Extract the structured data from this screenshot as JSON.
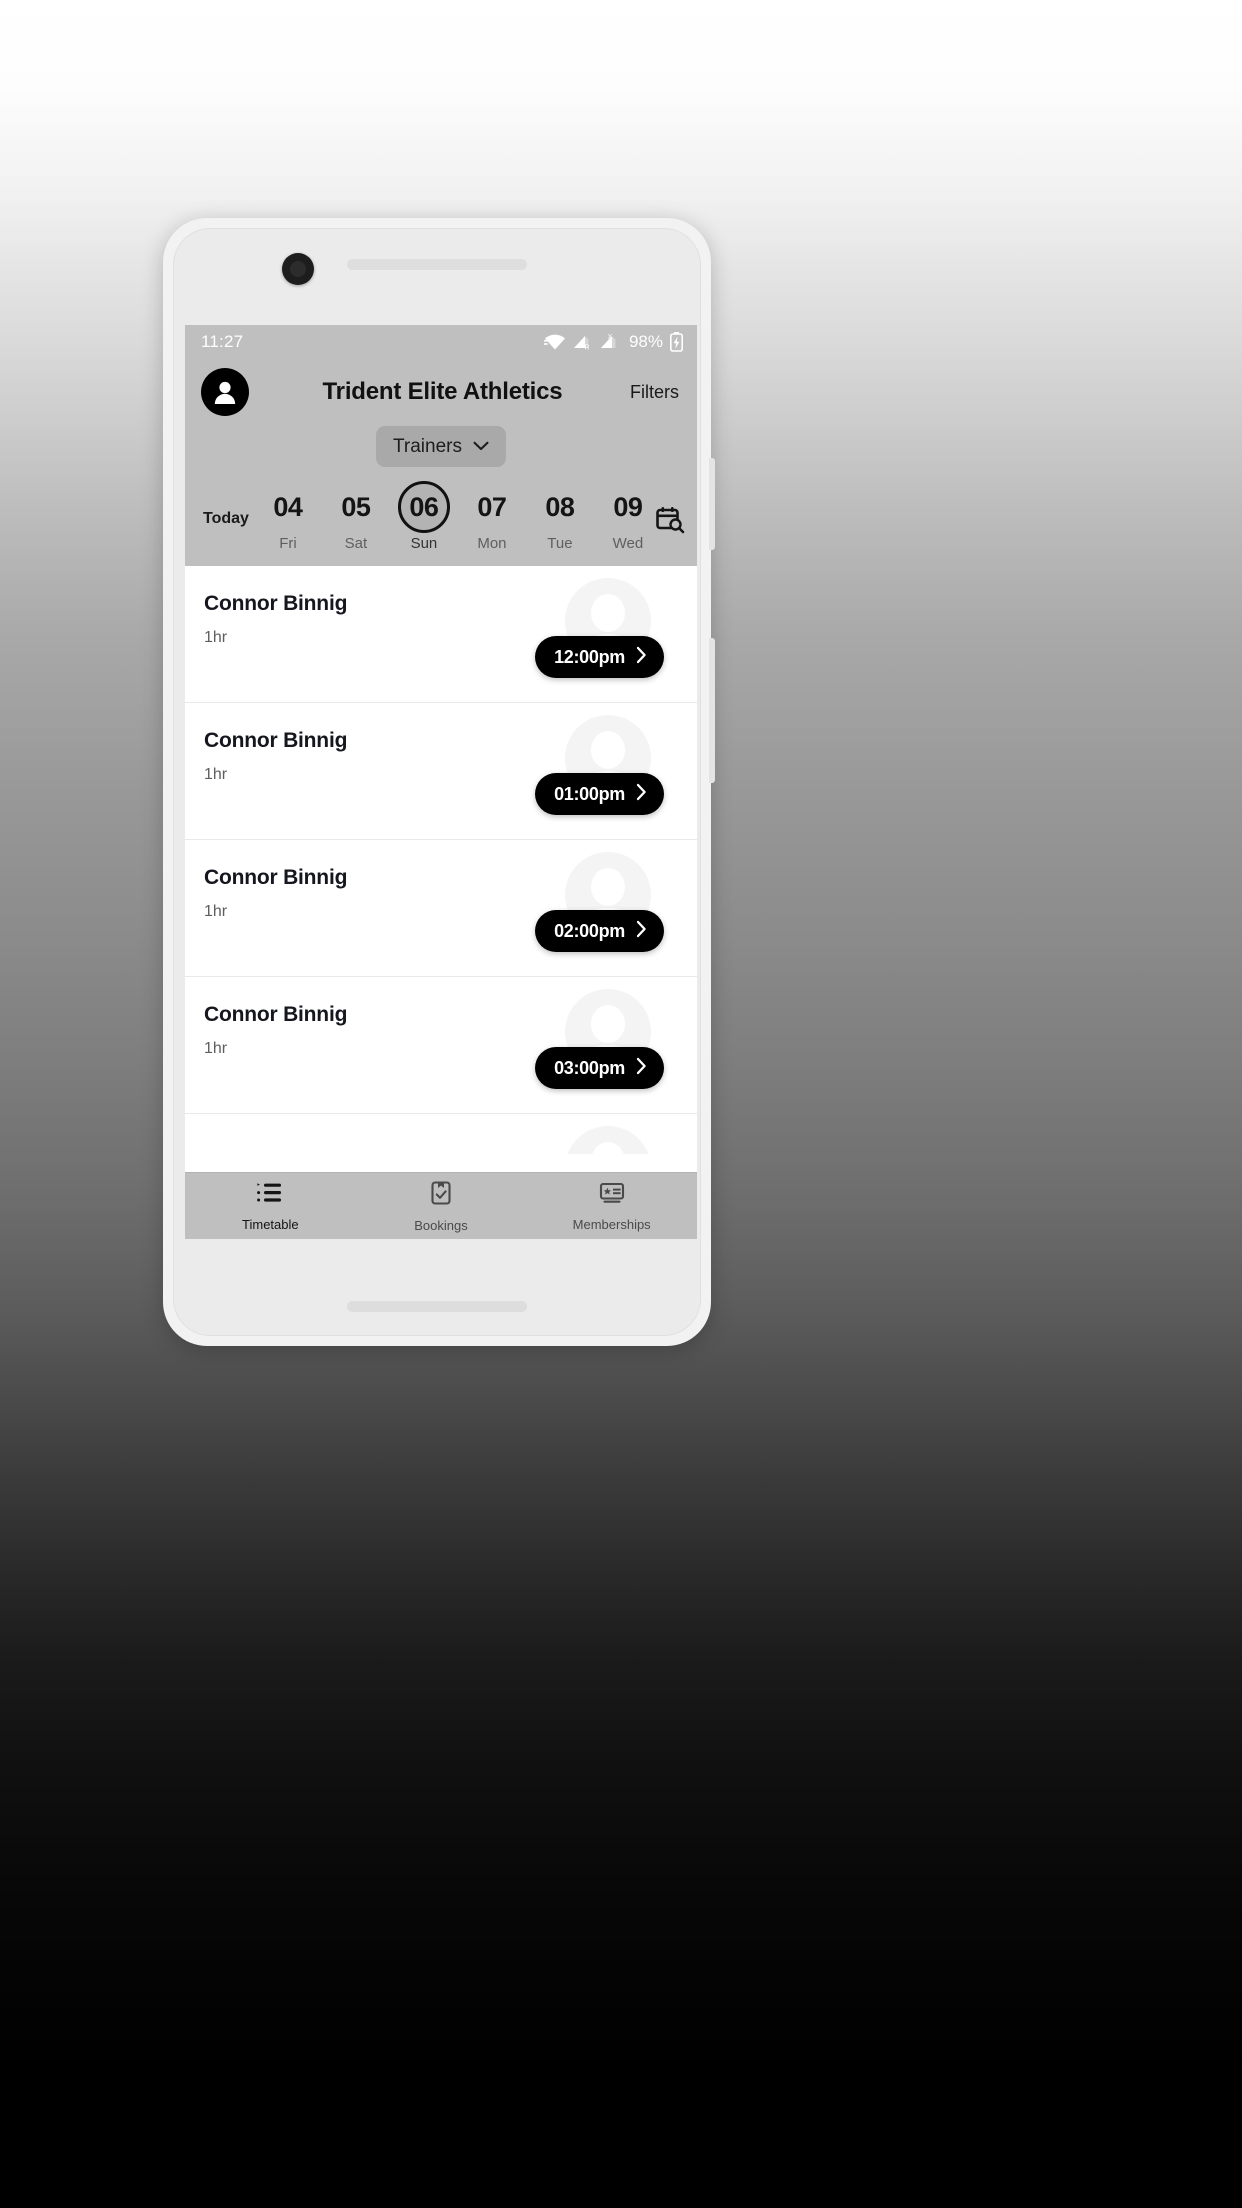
{
  "statusbar": {
    "time": "11:27",
    "battery_percent": "98%",
    "icons": [
      "wifi-icon",
      "cellular-roaming-icon",
      "cellular-no-sim-icon",
      "battery-charging-icon"
    ]
  },
  "header": {
    "avatar_name": "account-avatar",
    "title": "Trident Elite Athletics",
    "filters_label": "Filters"
  },
  "dropdown": {
    "label": "Trainers",
    "chevron": "chevron-down-icon"
  },
  "date_strip": {
    "today_label": "Today",
    "calendar_search_icon": "calendar-search-icon",
    "selected_index": 2,
    "dates": [
      {
        "num": "04",
        "dow": "Fri"
      },
      {
        "num": "05",
        "dow": "Sat"
      },
      {
        "num": "06",
        "dow": "Sun"
      },
      {
        "num": "07",
        "dow": "Mon"
      },
      {
        "num": "08",
        "dow": "Tue"
      },
      {
        "num": "09",
        "dow": "Wed"
      }
    ]
  },
  "sessions": [
    {
      "name": "Connor Binnig",
      "duration": "1hr",
      "time": "12:00pm"
    },
    {
      "name": "Connor Binnig",
      "duration": "1hr",
      "time": "01:00pm"
    },
    {
      "name": "Connor Binnig",
      "duration": "1hr",
      "time": "02:00pm"
    },
    {
      "name": "Connor Binnig",
      "duration": "1hr",
      "time": "03:00pm"
    }
  ],
  "bottom_nav": {
    "items": [
      {
        "label": "Timetable",
        "icon": "list-bullet-icon",
        "active": true
      },
      {
        "label": "Bookings",
        "icon": "clipboard-check-icon",
        "active": false
      },
      {
        "label": "Memberships",
        "icon": "membership-card-icon",
        "active": false
      }
    ]
  },
  "colors": {
    "chrome": "#bfbfbf",
    "accent_pill": "#000000",
    "screen_bg": "#ffffff",
    "phone_frame": "#f2f2f2"
  }
}
